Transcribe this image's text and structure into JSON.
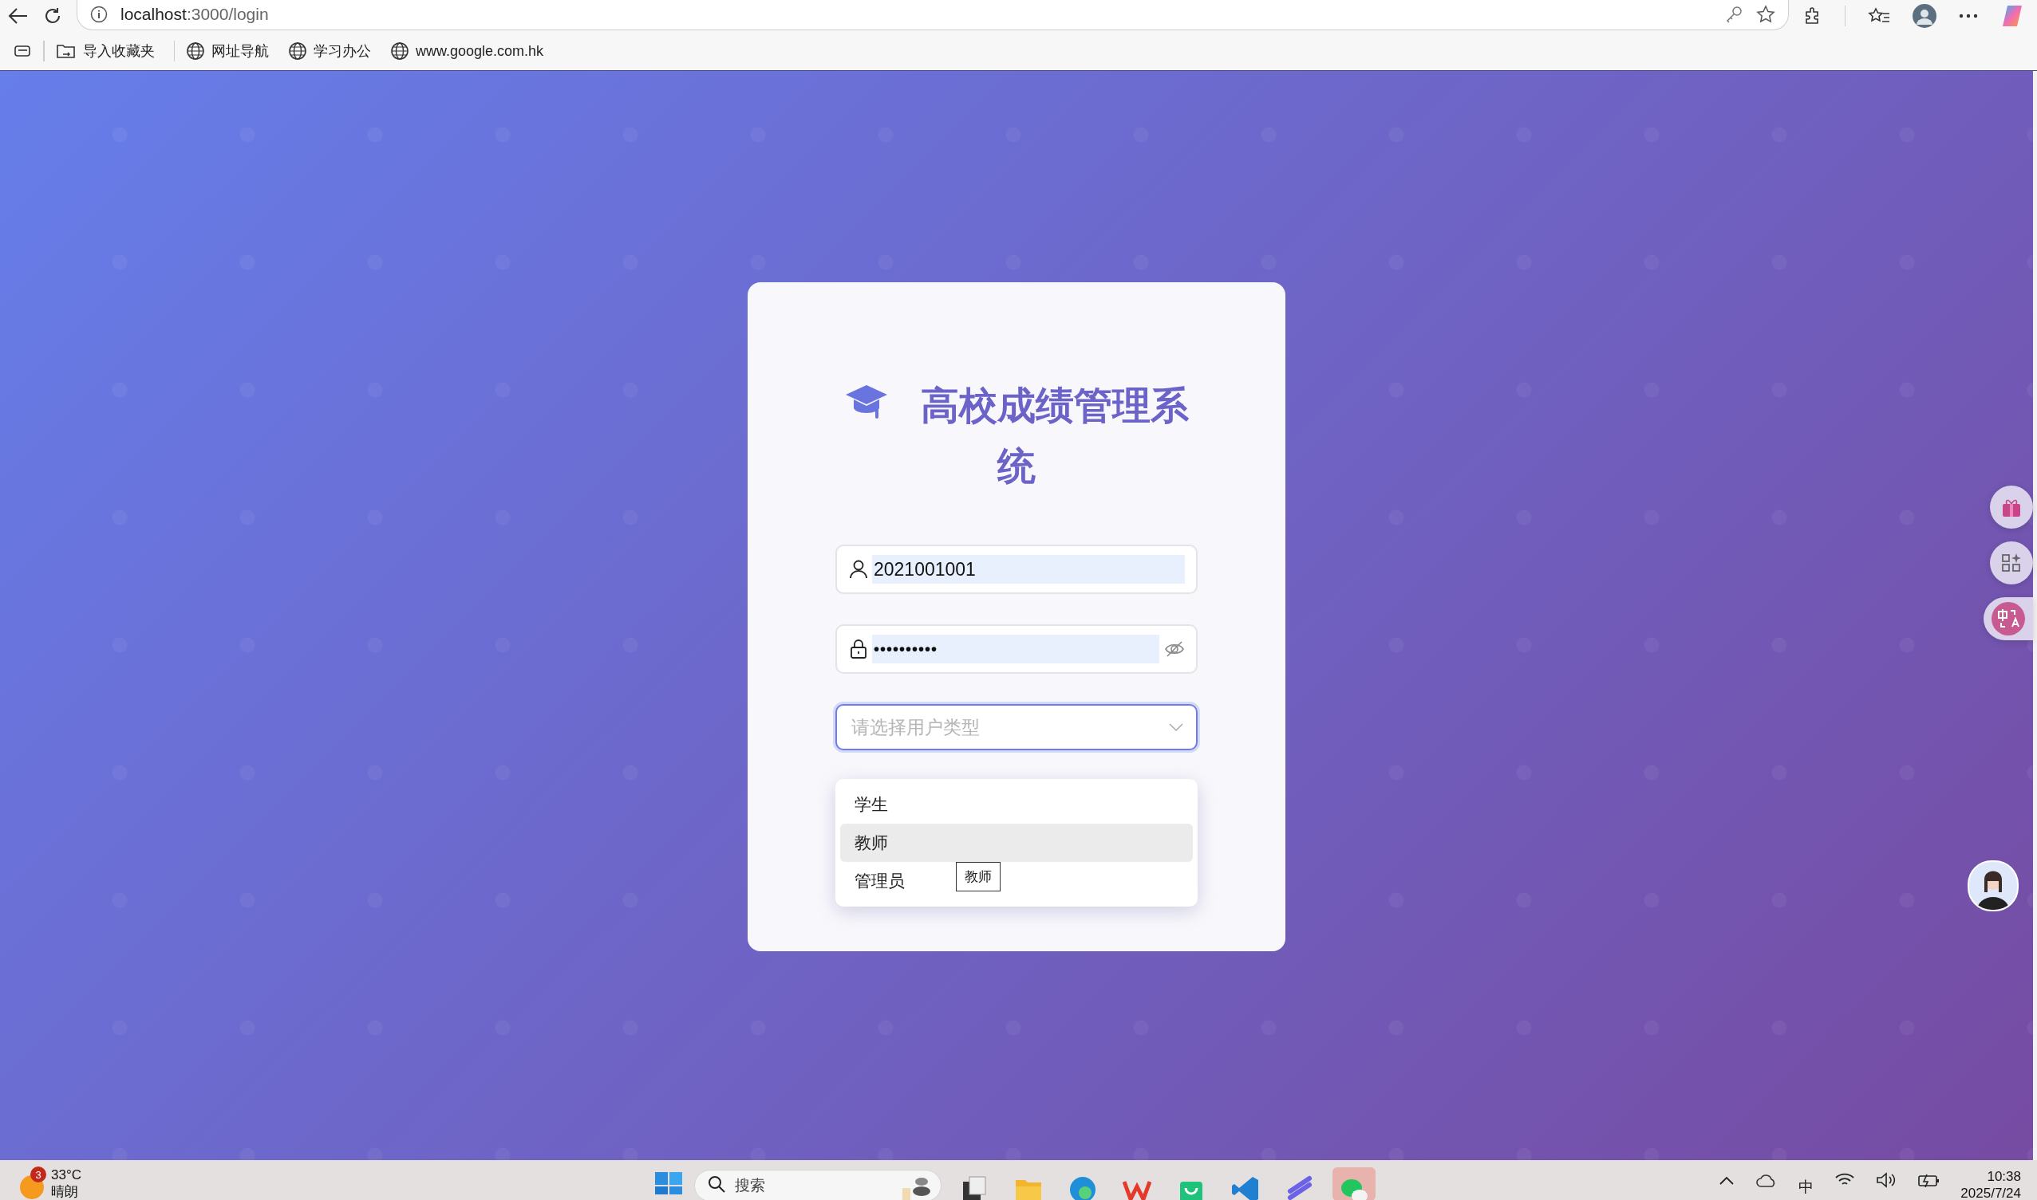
{
  "browser": {
    "url_host": "localhost",
    "url_path": ":3000/login",
    "bookmarks": [
      {
        "label": "导入收藏夹",
        "kind": "import"
      },
      {
        "label": "网址导航",
        "kind": "site"
      },
      {
        "label": "学习办公",
        "kind": "site"
      },
      {
        "label": "www.google.com.hk",
        "kind": "site"
      }
    ]
  },
  "login": {
    "title": "高校成绩管理系统",
    "username": {
      "value": "2021001001",
      "autofilled": true
    },
    "password": {
      "value": "••••••••••",
      "autofilled": true
    },
    "user_type": {
      "placeholder": "请选择用户类型",
      "focused": true,
      "options": [
        {
          "label": "学生",
          "hovered": false
        },
        {
          "label": "教师",
          "hovered": true
        },
        {
          "label": "管理员",
          "hovered": false
        }
      ]
    },
    "tooltip": "教师"
  },
  "taskbar": {
    "weather": {
      "temp": "33°C",
      "condition": "晴朗",
      "badge": "3"
    },
    "search": {
      "placeholder": "搜索"
    },
    "apps": [
      {
        "kind": "taskview",
        "active": false
      },
      {
        "kind": "files",
        "active": false
      },
      {
        "kind": "browser",
        "active": false
      },
      {
        "kind": "office",
        "active": false
      },
      {
        "kind": "store",
        "active": false
      },
      {
        "kind": "code",
        "active": false
      },
      {
        "kind": "feather",
        "active": false
      },
      {
        "kind": "chat",
        "active": true
      }
    ],
    "ime": "中",
    "time": "10:38",
    "date": "2025/7/24"
  }
}
